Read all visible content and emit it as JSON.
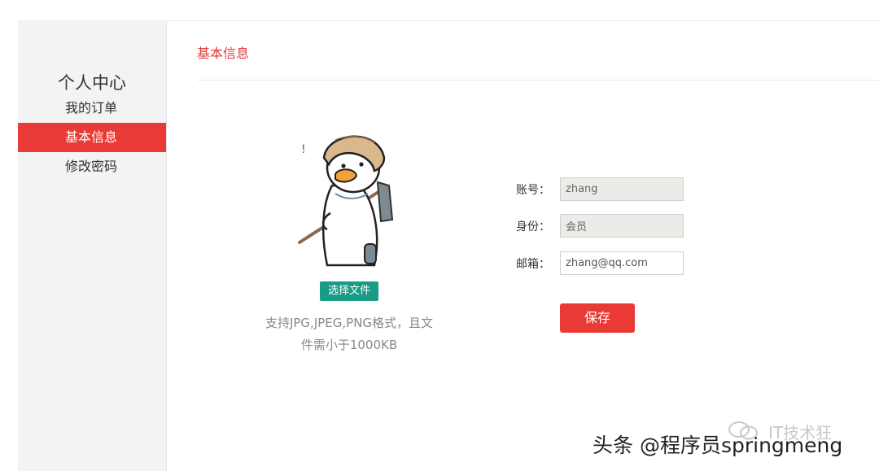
{
  "sidebar": {
    "title": "个人中心",
    "items": [
      {
        "label": "我的订单",
        "active": false
      },
      {
        "label": "基本信息",
        "active": true
      },
      {
        "label": "修改密码",
        "active": false
      }
    ]
  },
  "main": {
    "title": "基本信息",
    "avatar": {
      "icon": "duck-farmer-avatar"
    },
    "upload": {
      "button_label": "选择文件",
      "hint_line1": "支持JPG,JPEG,PNG格式，且文",
      "hint_line2": "件需小于1000KB"
    },
    "form": {
      "account_label": "账号：",
      "account_value": "zhang",
      "role_label": "身份：",
      "role_value": "会员",
      "email_label": "邮箱：",
      "email_value": "zhang@qq.com",
      "save_label": "保存"
    }
  },
  "watermark": {
    "brand_text": "IT技术狂",
    "author_text": "头条 @程序员springmeng",
    "icon": "wechat-icon"
  },
  "colors": {
    "accent": "#e93a35",
    "upload_button": "#1a9b86",
    "sidebar_bg": "#f3f3f3"
  }
}
